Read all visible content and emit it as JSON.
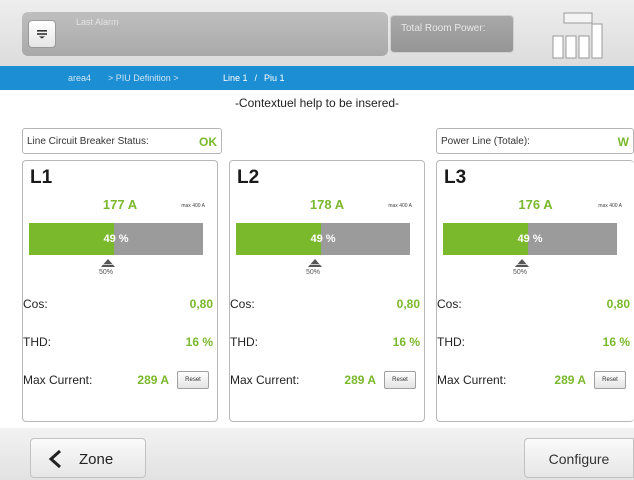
{
  "header": {
    "alarm_label": "Last Alarm",
    "power_label": "Total Room Power:"
  },
  "breadcrumb": {
    "area": "area4",
    "mid": "> PIU Definition > ",
    "line": "Line 1",
    "sep": " / ",
    "piu": "Piu 1"
  },
  "help_text": "-Contextuel help to be insered-",
  "status": {
    "breaker_label": "Line Circuit Breaker Status:",
    "breaker_value": "OK",
    "power_label": "Power Line (Totale):",
    "power_value": "W"
  },
  "lines": [
    {
      "title": "L1",
      "current": "177 A",
      "max": "max 400 A",
      "percent_label": "49 %",
      "percent": 49,
      "marker": "50%",
      "cos_label": "Cos:",
      "cos": "0,80",
      "thd_label": "THD:",
      "thd": "16 %",
      "maxcur_label": "Max Current:",
      "maxcur": "289 A",
      "reset": "Reset"
    },
    {
      "title": "L2",
      "current": "178 A",
      "max": "max 400 A",
      "percent_label": "49 %",
      "percent": 49,
      "marker": "50%",
      "cos_label": "Cos:",
      "cos": "0,80",
      "thd_label": "THD:",
      "thd": "16 %",
      "maxcur_label": "Max Current:",
      "maxcur": "289 A",
      "reset": "Reset"
    },
    {
      "title": "L3",
      "current": "176 A",
      "max": "max 400 A",
      "percent_label": "49 %",
      "percent": 49,
      "marker": "50%",
      "cos_label": "Cos:",
      "cos": "0,80",
      "thd_label": "THD:",
      "thd": "16 %",
      "maxcur_label": "Max Current:",
      "maxcur": "289 A",
      "reset": "Reset"
    }
  ],
  "footer": {
    "zone_label": "Zone",
    "configure_label": "Configure"
  },
  "colors": {
    "accent_green": "#7ab82c",
    "breadcrumb_blue": "#1c8ed3",
    "bar_gray": "#9b9b9b"
  }
}
